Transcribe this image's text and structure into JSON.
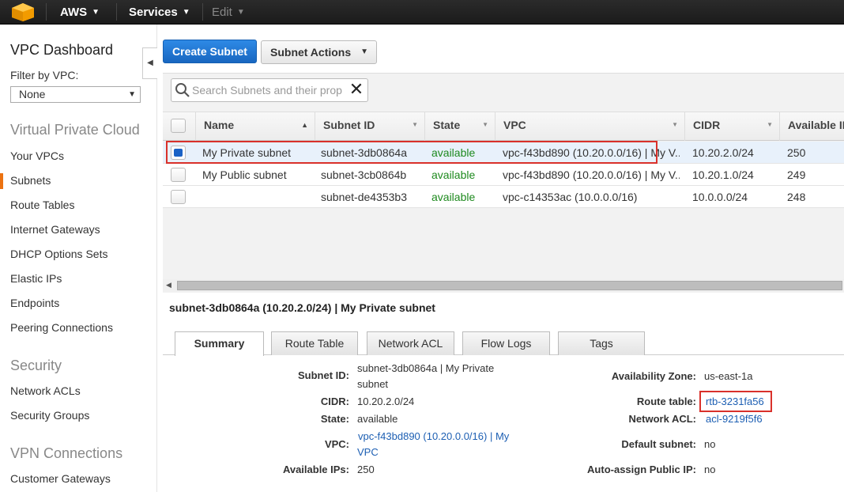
{
  "topbar": {
    "brand": "AWS",
    "services": "Services",
    "edit": "Edit"
  },
  "sidebar": {
    "title": "VPC Dashboard",
    "filter_label": "Filter by VPC:",
    "filter_value": "None",
    "sections": [
      {
        "title": "Virtual Private Cloud",
        "items": [
          "Your VPCs",
          "Subnets",
          "Route Tables",
          "Internet Gateways",
          "DHCP Options Sets",
          "Elastic IPs",
          "Endpoints",
          "Peering Connections"
        ]
      },
      {
        "title": "Security",
        "items": [
          "Network ACLs",
          "Security Groups"
        ]
      },
      {
        "title": "VPN Connections",
        "items": [
          "Customer Gateways"
        ]
      }
    ],
    "active_item": "Subnets"
  },
  "toolbar": {
    "create_label": "Create Subnet",
    "actions_label": "Subnet Actions"
  },
  "search": {
    "placeholder": "Search Subnets and their prop"
  },
  "table": {
    "columns": [
      "Name",
      "Subnet ID",
      "State",
      "VPC",
      "CIDR",
      "Available IP"
    ],
    "rows": [
      {
        "name": "My Private subnet",
        "subnet_id": "subnet-3db0864a",
        "state": "available",
        "vpc": "vpc-f43bd890 (10.20.0.0/16) | My V...",
        "cidr": "10.20.2.0/24",
        "ips": "250",
        "selected": true
      },
      {
        "name": "My Public subnet",
        "subnet_id": "subnet-3cb0864b",
        "state": "available",
        "vpc": "vpc-f43bd890 (10.20.0.0/16) | My V...",
        "cidr": "10.20.1.0/24",
        "ips": "249",
        "selected": false
      },
      {
        "name": "",
        "subnet_id": "subnet-de4353b3",
        "state": "available",
        "vpc": "vpc-c14353ac (10.0.0.0/16)",
        "cidr": "10.0.0.0/24",
        "ips": "248",
        "selected": false
      }
    ]
  },
  "detail": {
    "title": "subnet-3db0864a (10.20.2.0/24) | My Private subnet",
    "tabs": [
      "Summary",
      "Route Table",
      "Network ACL",
      "Flow Logs",
      "Tags"
    ],
    "active_tab": "Summary",
    "left": {
      "subnet_id_label": "Subnet ID:",
      "subnet_id_value_1": "subnet-3db0864a | My Private",
      "subnet_id_value_2": "subnet",
      "cidr_label": "CIDR:",
      "cidr_value": "10.20.2.0/24",
      "state_label": "State:",
      "state_value": "available",
      "vpc_label": "VPC:",
      "vpc_value_1": "vpc-f43bd890 (10.20.0.0/16) | My",
      "vpc_value_2": "VPC",
      "ips_label": "Available IPs:",
      "ips_value": "250"
    },
    "right": {
      "az_label": "Availability Zone:",
      "az_value": "us-east-1a",
      "rt_label": "Route table:",
      "rt_value": "rtb-3231fa56",
      "acl_label": "Network ACL:",
      "acl_value": "acl-9219f5f6",
      "default_label": "Default subnet:",
      "default_value": "no",
      "auto_label": "Auto-assign Public IP:",
      "auto_value": "no"
    }
  },
  "colors": {
    "accent_orange": "#ec7211",
    "primary_blue": "#1b75d0",
    "highlight_red": "#d9312b",
    "state_green": "#1e8a1e",
    "link_blue": "#1d5fb3"
  }
}
